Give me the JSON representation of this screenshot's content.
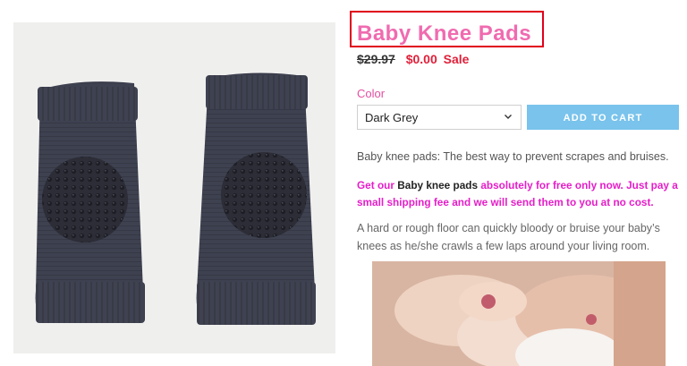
{
  "product": {
    "title": "Baby Knee Pads",
    "old_price": "$29.97",
    "sale_price": "$0.00",
    "sale_label": "Sale",
    "image_alt_icon": "knee-pads-image"
  },
  "options": {
    "color_label": "Color",
    "color_selected": "Dark Grey",
    "add_to_cart_label": "ADD TO CART"
  },
  "description": {
    "intro": "Baby knee pads: The best way to prevent scrapes and bruises.",
    "promo_prefix": "Get our ",
    "promo_emphasis": "Baby knee pads",
    "promo_rest": " absolutely for free only now. Just pay a small shipping fee and we will send them to you at no cost.",
    "body": "A hard or rough floor can quickly bloody or bruise your baby’s knees as he/she crawls a few laps around your living room."
  },
  "colors": {
    "title_pink": "#f06bb0",
    "sale_red": "#e0203a",
    "promo_magenta": "#e61ec9",
    "button_blue": "#79c3ec",
    "highlight_box": "#e0001a"
  }
}
